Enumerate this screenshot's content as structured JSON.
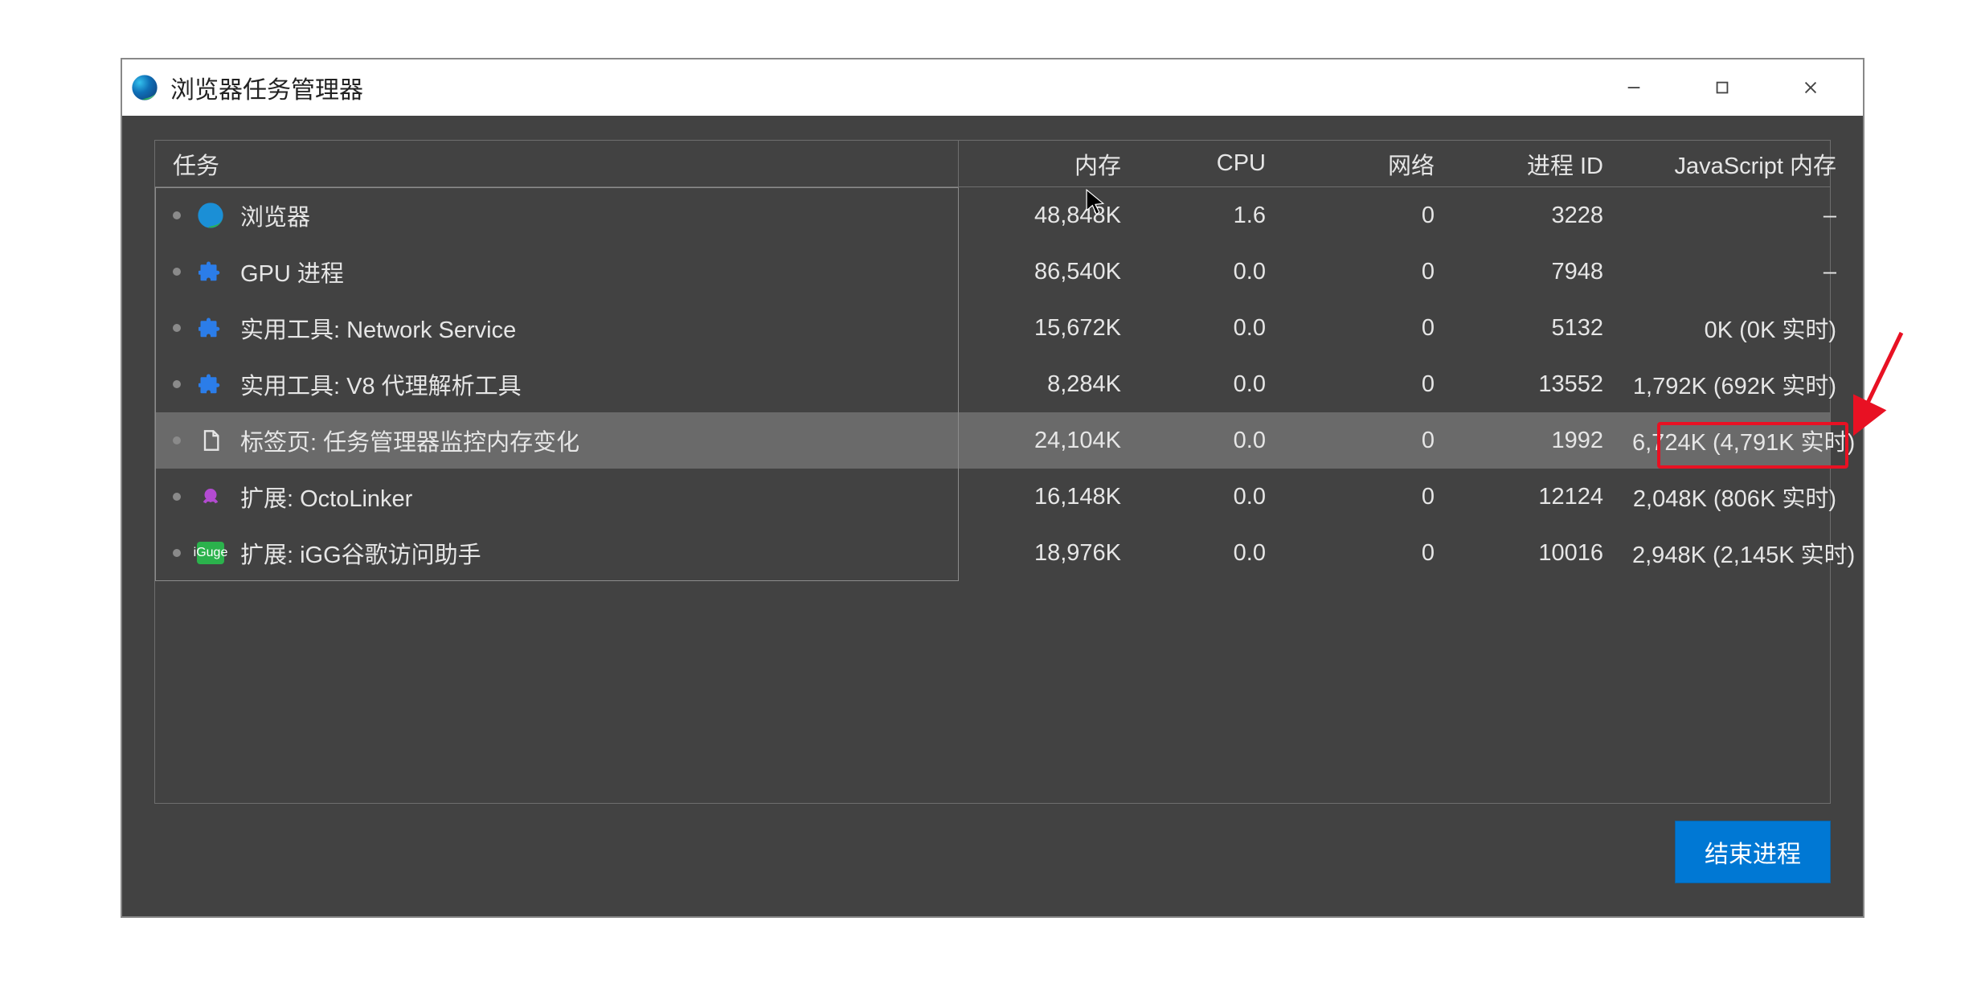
{
  "window": {
    "title": "浏览器任务管理器"
  },
  "columns": {
    "task": "任务",
    "memory": "内存",
    "cpu": "CPU",
    "network": "网络",
    "pid": "进程 ID",
    "jsmem": "JavaScript 内存"
  },
  "rows": [
    {
      "icon": "edge",
      "label": "浏览器",
      "memory": "48,848K",
      "cpu": "1.6",
      "network": "0",
      "pid": "3228",
      "jsmem": "–",
      "selected": false
    },
    {
      "icon": "puzzle",
      "label": "GPU 进程",
      "memory": "86,540K",
      "cpu": "0.0",
      "network": "0",
      "pid": "7948",
      "jsmem": "–",
      "selected": false
    },
    {
      "icon": "puzzle",
      "label": "实用工具: Network Service",
      "memory": "15,672K",
      "cpu": "0.0",
      "network": "0",
      "pid": "5132",
      "jsmem": "0K (0K 实时)",
      "selected": false
    },
    {
      "icon": "puzzle",
      "label": "实用工具: V8 代理解析工具",
      "memory": "8,284K",
      "cpu": "0.0",
      "network": "0",
      "pid": "13552",
      "jsmem": "1,792K (692K 实时)",
      "selected": false
    },
    {
      "icon": "doc",
      "label": "标签页: 任务管理器监控内存变化",
      "memory": "24,104K",
      "cpu": "0.0",
      "network": "0",
      "pid": "1992",
      "jsmem": "6,724K (4,791K 实时)",
      "selected": true
    },
    {
      "icon": "octo",
      "label": "扩展: OctoLinker",
      "memory": "16,148K",
      "cpu": "0.0",
      "network": "0",
      "pid": "12124",
      "jsmem": "2,048K (806K 实时)",
      "selected": false
    },
    {
      "icon": "iguge",
      "label": "扩展: iGG谷歌访问助手",
      "memory": "18,976K",
      "cpu": "0.0",
      "network": "0",
      "pid": "10016",
      "jsmem": "2,948K (2,145K 实时)",
      "selected": false
    }
  ],
  "footer": {
    "end_process": "结束进程"
  },
  "icons": {
    "iguge_badge": "iGuge"
  }
}
